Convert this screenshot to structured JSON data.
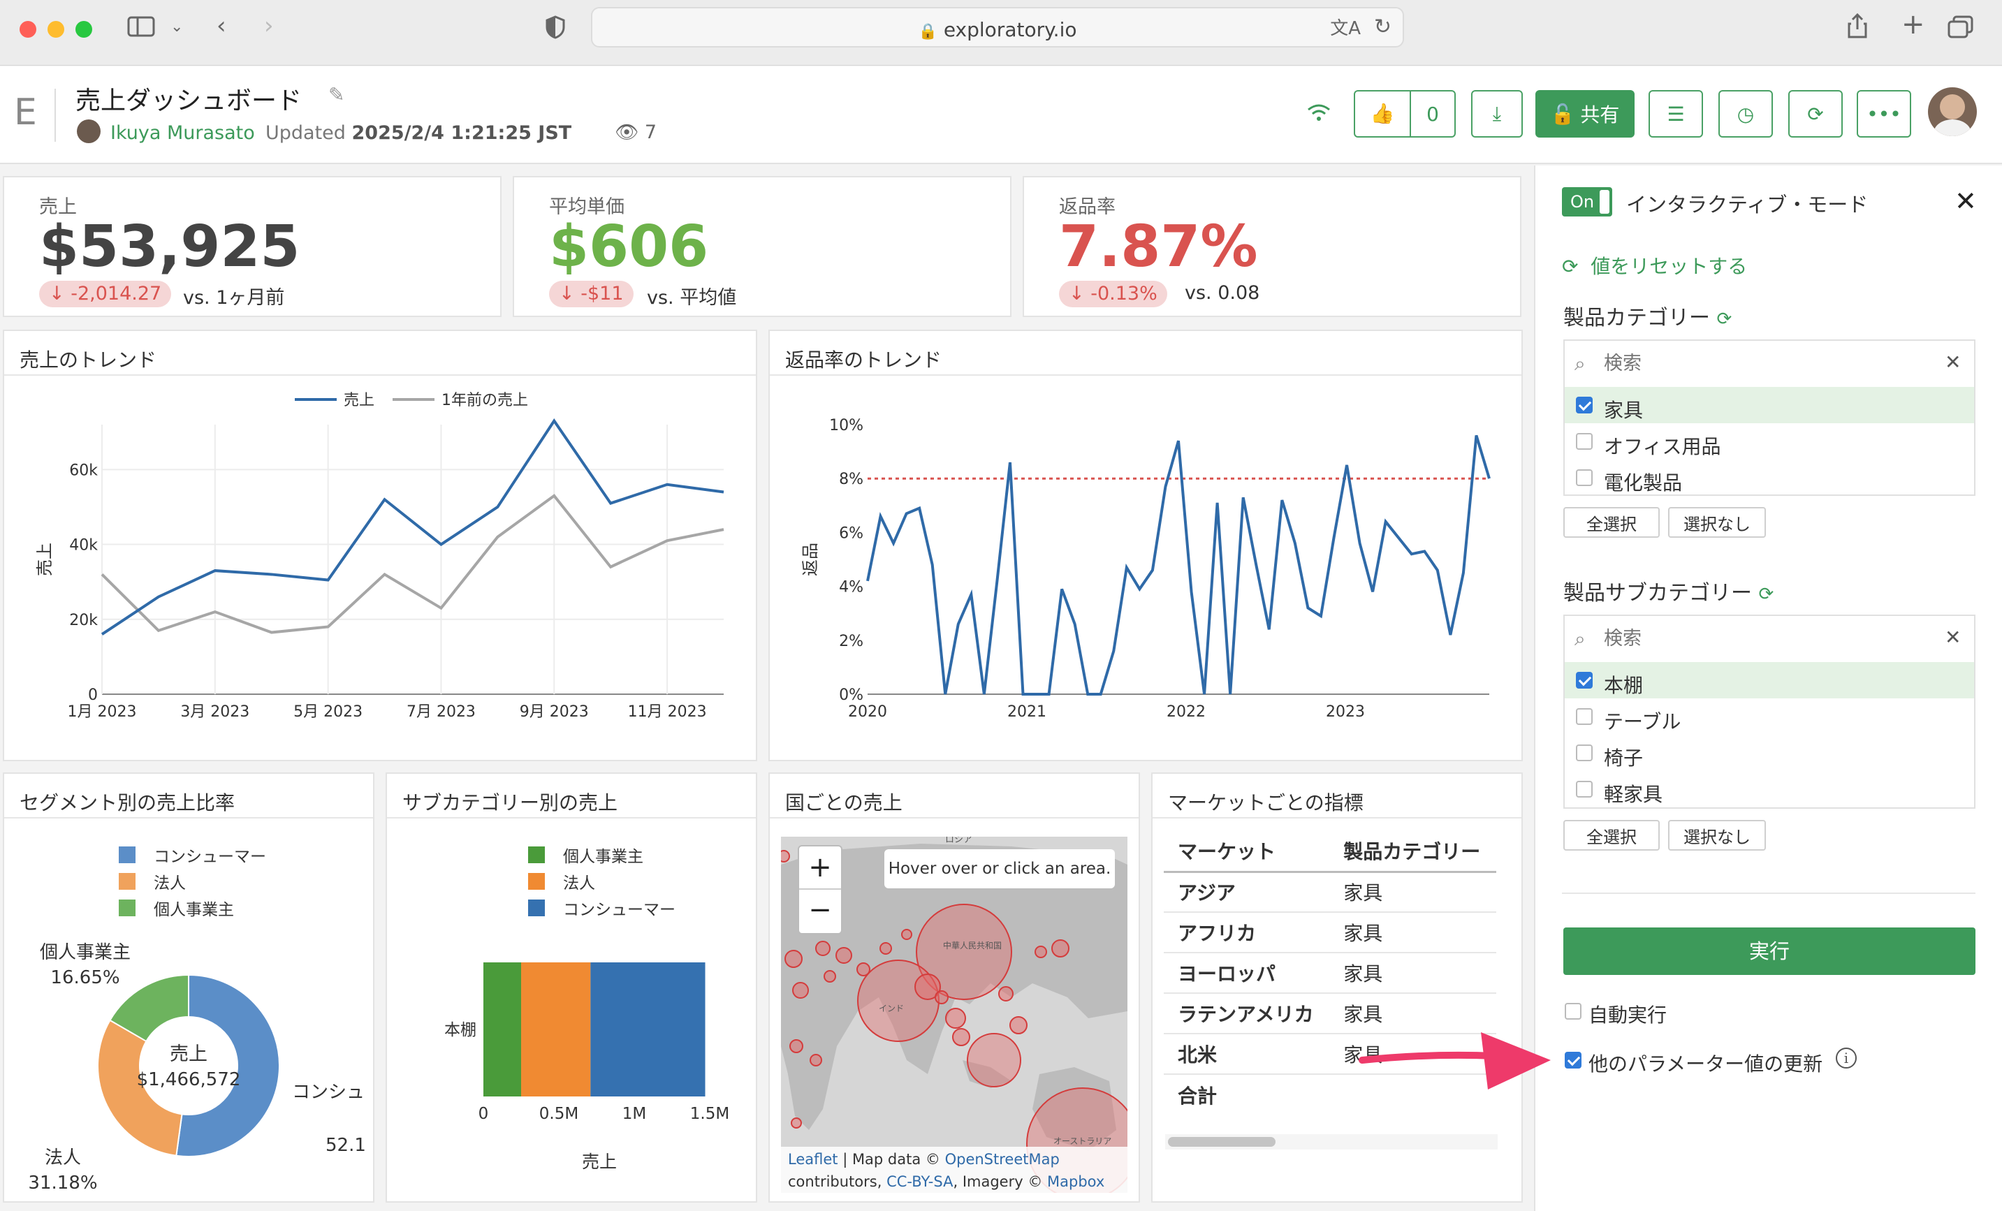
{
  "browser": {
    "url": "exploratory.io"
  },
  "header": {
    "logo": "E",
    "title": "売上ダッシュボード",
    "author": "Ikuya Murasato",
    "updated_label": "Updated",
    "updated_value": "2025/2/4 1:21:25 JST",
    "views": "7",
    "like_count": "0",
    "share_label": "共有"
  },
  "kpis": [
    {
      "label": "売上",
      "value": "$53,925",
      "delta": "-2,014.27",
      "vs": "vs. 1ヶ月前",
      "color": "#444444"
    },
    {
      "label": "平均単価",
      "value": "$606",
      "delta": "-$11",
      "vs": "vs. 平均値",
      "color": "#6db24a"
    },
    {
      "label": "返品率",
      "value": "7.87%",
      "delta": "-0.13%",
      "vs": "vs. 0.08",
      "color": "#d9534f"
    }
  ],
  "sales_trend": {
    "title": "売上のトレンド",
    "ylabel": "売上",
    "legend": [
      "売上",
      "1年前の売上"
    ]
  },
  "return_trend": {
    "title": "返品率のトレンド",
    "ylabel": "返品"
  },
  "segment_pie": {
    "title": "セグメント別の売上比率",
    "legend": [
      "コンシューマー",
      "法人",
      "個人事業主"
    ],
    "center_label": "売上",
    "center_value": "$1,466,572",
    "label_individual": "個人事業主",
    "pct_individual": "16.65%",
    "label_corp": "法人",
    "pct_corp": "31.18%",
    "label_consumer": "コンシュ",
    "pct_consumer": "52.1"
  },
  "subcat_bar": {
    "title": "サブカテゴリー別の売上",
    "legend": [
      "個人事業主",
      "法人",
      "コンシューマー"
    ],
    "category": "本棚",
    "xlabel": "売上"
  },
  "country_map": {
    "title": "国ごとの売上",
    "hover_text": "Hover over or click an area.",
    "label_russia": "ロシア",
    "label_china": "中華人民共和国",
    "label_india": "インド",
    "label_australia": "オーストラリア",
    "attr_leaflet": "Leaflet",
    "attr_mapdata": " | Map data © ",
    "attr_osm": "OpenStreetMap",
    "attr_contrib": "contributors, ",
    "attr_cc": "CC-BY-SA",
    "attr_imagery": ", Imagery © ",
    "attr_mapbox": "Mapbox"
  },
  "market_table": {
    "title": "マーケットごとの指標",
    "headers": [
      "マーケット",
      "製品カテゴリー"
    ],
    "rows": [
      [
        "アジア",
        "家具"
      ],
      [
        "アフリカ",
        "家具"
      ],
      [
        "ヨーロッパ",
        "家具"
      ],
      [
        "ラテンアメリカ",
        "家具"
      ],
      [
        "北米",
        "家具"
      ]
    ],
    "total": "合計"
  },
  "sidebar": {
    "toggle": "On",
    "mode_label": "インタラクティブ・モード",
    "reset_label": "値をリセットする",
    "cat_title": "製品カテゴリー",
    "search_placeholder": "検索",
    "categories": [
      "家具",
      "オフィス用品",
      "電化製品"
    ],
    "subcat_title": "製品サブカテゴリー",
    "subcategories": [
      "本棚",
      "テーブル",
      "椅子",
      "軽家具"
    ],
    "select_all": "全選択",
    "select_none": "選択なし",
    "run": "実行",
    "auto_run": "自動実行",
    "update_params": "他のパラメーター値の更新"
  },
  "chart_data": [
    {
      "type": "line",
      "title": "売上のトレンド",
      "ylabel": "売上",
      "x": [
        "2023-01",
        "2023-02",
        "2023-03",
        "2023-04",
        "2023-05",
        "2023-06",
        "2023-07",
        "2023-08",
        "2023-09",
        "2023-10",
        "2023-11",
        "2023-12"
      ],
      "x_ticks": [
        "1月 2023",
        "3月 2023",
        "5月 2023",
        "7月 2023",
        "9月 2023",
        "11月 2023"
      ],
      "y_ticks": [
        "0",
        "20k",
        "40k",
        "60k"
      ],
      "ylim": [
        0,
        72000
      ],
      "series": [
        {
          "name": "売上",
          "color": "#2f6aa8",
          "values": [
            16000,
            26000,
            33000,
            32000,
            30500,
            52000,
            40000,
            50000,
            73000,
            51000,
            56000,
            54000
          ]
        },
        {
          "name": "1年前の売上",
          "color": "#a6a6a6",
          "values": [
            32000,
            17000,
            22000,
            16500,
            18000,
            32000,
            23000,
            42000,
            53000,
            34000,
            41000,
            44000
          ]
        }
      ]
    },
    {
      "type": "line",
      "title": "返品率のトレンド",
      "ylabel": "返品",
      "x_ticks": [
        "2020",
        "2021",
        "2022",
        "2023"
      ],
      "y_ticks": [
        "0%",
        "2%",
        "4%",
        "6%",
        "8%",
        "10%"
      ],
      "ylim": [
        0,
        10
      ],
      "reference_line": 8,
      "series": [
        {
          "name": "",
          "color": "#2f6aa8",
          "values": [
            4.2,
            6.6,
            5.6,
            6.7,
            6.9,
            4.8,
            0,
            2.6,
            3.7,
            0,
            4.2,
            8.6,
            0,
            0,
            0,
            3.9,
            2.6,
            0,
            0,
            1.6,
            4.7,
            3.9,
            4.6,
            7.7,
            9.4,
            3.8,
            0,
            7.1,
            0,
            7.3,
            4.8,
            2.4,
            7.2,
            5.6,
            3.2,
            2.9,
            5.8,
            8.5,
            5.6,
            3.8,
            6.4,
            5.8,
            5.2,
            5.3,
            4.6,
            2.2,
            4.5,
            9.6,
            8.0
          ]
        }
      ]
    },
    {
      "type": "pie",
      "title": "セグメント別の売上比率",
      "labels": [
        "コンシューマー",
        "法人",
        "個人事業主"
      ],
      "values": [
        52.17,
        31.18,
        16.65
      ],
      "colors": [
        "#5b8ec8",
        "#f0a25c",
        "#6db35e"
      ]
    },
    {
      "type": "bar",
      "title": "サブカテゴリー別の売上",
      "categories": [
        "本棚"
      ],
      "xlabel": "売上",
      "x_ticks": [
        "0",
        "0.5M",
        "1M",
        "1.5M"
      ],
      "xlim": [
        0,
        1500000
      ],
      "series": [
        {
          "name": "個人事業主",
          "color": "#4a9b3a",
          "values": [
            250000
          ]
        },
        {
          "name": "法人",
          "color": "#f08a32",
          "values": [
            460000
          ]
        },
        {
          "name": "コンシューマー",
          "color": "#3571b0",
          "values": [
            760000
          ]
        }
      ]
    }
  ]
}
